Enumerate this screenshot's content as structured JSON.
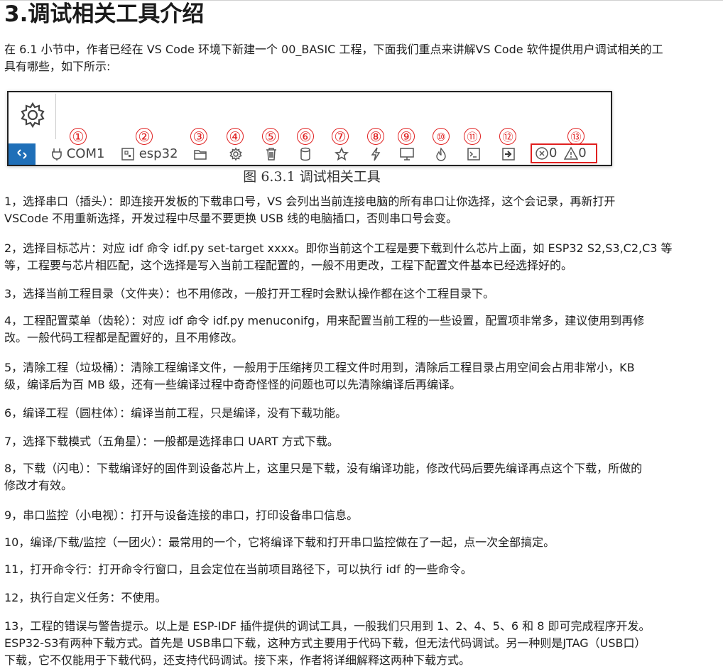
{
  "title": "3.调试相关工具介绍",
  "intro": "在 6.1 小节中，作者已经在 VS Code 环境下新建一个 00_BASIC 工程，下面我们重点来讲解VS Code 软件提供用户调试相关的工\n具有哪些，如下所示:",
  "figure": {
    "caption": "图 6.3.1 调试相关工具",
    "remote_icon": "remote-icon",
    "items": [
      {
        "num": "①",
        "label": "COM1",
        "icon": "plug-icon"
      },
      {
        "num": "②",
        "label": "esp32",
        "icon": "chip-icon"
      },
      {
        "num": "③",
        "label": "",
        "icon": "folder-icon"
      },
      {
        "num": "④",
        "label": "",
        "icon": "gear-icon"
      },
      {
        "num": "⑤",
        "label": "",
        "icon": "trash-icon"
      },
      {
        "num": "⑥",
        "label": "",
        "icon": "cylinder-icon"
      },
      {
        "num": "⑦",
        "label": "",
        "icon": "star-icon"
      },
      {
        "num": "⑧",
        "label": "",
        "icon": "flash-icon"
      },
      {
        "num": "⑨",
        "label": "",
        "icon": "monitor-icon"
      },
      {
        "num": "⑩",
        "label": "",
        "icon": "flame-icon"
      },
      {
        "num": "⑪",
        "label": "",
        "icon": "terminal-icon"
      },
      {
        "num": "⑫",
        "label": "",
        "icon": "run-task-icon"
      },
      {
        "num": "⑬",
        "label": "",
        "icon": "problems-icon"
      }
    ],
    "errors_count": "0",
    "warnings_count": "0"
  },
  "items": [
    "1，选择串口（插头）：即连接开发板的下载串口号，VS 会列出当前连接电脑的所有串口让你选择，这个会记录，再新打开\nVSCode 不用重新选择，开发过程中尽量不要更换 USB 线的电脑插口，否则串口号会变。",
    "2，选择目标芯片：对应 idf 命令 idf.py set-target xxxx。即你当前这个工程是要下载到什么芯片上面，如 ESP32 S2,S3,C2,C3 等\n等，工程要与芯片相匹配，这个选择是写入当前工程配置的，一般不用更改，工程下配置文件基本已经选择好的。",
    "3，选择当前工程目录（文件夹）：也不用修改，一般打开工程时会默认操作都在这个工程目录下。",
    "4，工程配置菜单（齿轮）：对应 idf 命令 idf.py menuconifg，用来配置当前工程的一些设置，配置项非常多，建议使用到再修\n改。一般代码工程都是配置好的，且不用修改。",
    "5，清除工程（垃圾桶）：清除工程编译文件，一般用于压缩拷贝工程文件时用到，清除后工程目录占用空间会占用非常小，KB\n级，编译后为百 MB 级，还有一些编译过程中奇奇怪怪的问题也可以先清除编译后再编译。",
    "6，编译工程（圆柱体）：编译当前工程，只是编译，没有下载功能。",
    "7，选择下载模式（五角星）：一般都是选择串口 UART 方式下载。",
    "8，下载（闪电）：下载编译好的固件到设备芯片上，这里只是下载，没有编译功能，修改代码后要先编译再点这个下载，所做的\n修改才有效。",
    "9，串口监控（小电视）：打开与设备连接的串口，打印设备串口信息。",
    "10，编译/下载/监控（一团火）：最常用的一个，它将编译下载和打开串口监控做在了一起，点一次全部搞定。",
    "11，打开命令行：打开命令行窗口，且会定位在当前项目路径下，可以执行 idf 的一些命令。",
    "12，执行自定义任务：不使用。",
    "13，工程的错误与警告提示。以上是 ESP-IDF 插件提供的调试工具，一般我们只用到 1、2、4、5、6 和 8 即可完成程序开发。\nESP32-S3有两种下载方式。首先是 USB串口下载，这种方式主要用于代码下载，但无法代码调试。另一种则是JTAG（USB口）\n下载，它不仅能用于下载代码，还支持代码调试。接下来，作者将详细解释这两种下载方式。"
  ]
}
